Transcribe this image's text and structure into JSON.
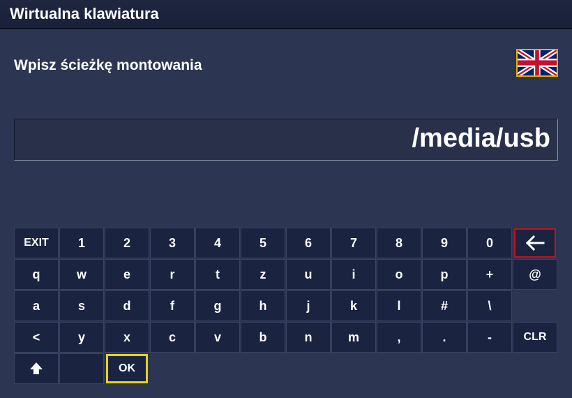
{
  "window": {
    "title": "Wirtualna klawiatura"
  },
  "prompt": "Wpisz ścieżkę montowania",
  "language_flag": {
    "icon": "uk-flag-icon",
    "border_color": "#e0b000"
  },
  "input": {
    "value": "/media/usb"
  },
  "keyboard": {
    "row1": [
      "EXIT",
      "1",
      "2",
      "3",
      "4",
      "5",
      "6",
      "7",
      "8",
      "9",
      "0"
    ],
    "row2": [
      "q",
      "w",
      "e",
      "r",
      "t",
      "z",
      "u",
      "i",
      "o",
      "p",
      "+",
      "@"
    ],
    "row3": [
      "a",
      "s",
      "d",
      "f",
      "g",
      "h",
      "j",
      "k",
      "l",
      "#",
      "\\"
    ],
    "row4": [
      "<",
      "y",
      "x",
      "c",
      "v",
      "b",
      "n",
      "m",
      ",",
      ".",
      "-",
      "CLR"
    ],
    "ok": "OK",
    "backspace_icon": "left-arrow-icon",
    "shift_icon": "up-arrow-icon",
    "colors": {
      "background": "#2c3552",
      "key": "#1a2340",
      "selected": "#e8d21a",
      "delete_highlight": "#c4121f"
    }
  }
}
